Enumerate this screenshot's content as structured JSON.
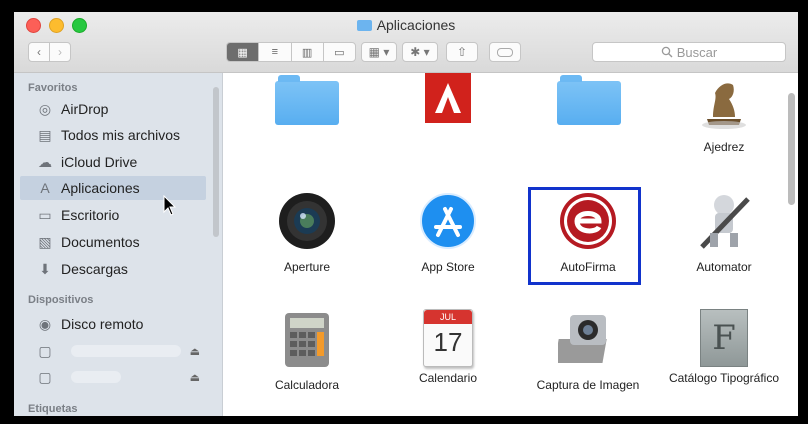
{
  "window": {
    "title": "Aplicaciones"
  },
  "toolbar": {
    "back": "‹",
    "forward": "›",
    "view_icons": "▦",
    "view_list": "≡",
    "view_columns": "▥",
    "view_coverflow": "▭",
    "arrange": "▦ ▾",
    "action": "✱ ▾",
    "share": "⇧",
    "search_placeholder": "Buscar"
  },
  "sidebar": {
    "favorites_label": "Favoritos",
    "favorites": [
      {
        "label": "AirDrop",
        "icon": "airdrop-icon",
        "glyph": "◎"
      },
      {
        "label": "Todos mis archivos",
        "icon": "all-files-icon",
        "glyph": "▤"
      },
      {
        "label": "iCloud Drive",
        "icon": "cloud-icon",
        "glyph": "☁"
      },
      {
        "label": "Aplicaciones",
        "icon": "applications-icon",
        "glyph": "A"
      },
      {
        "label": "Escritorio",
        "icon": "desktop-icon",
        "glyph": "▭"
      },
      {
        "label": "Documentos",
        "icon": "documents-icon",
        "glyph": "▧"
      },
      {
        "label": "Descargas",
        "icon": "downloads-icon",
        "glyph": "⬇"
      }
    ],
    "devices_label": "Dispositivos",
    "devices": [
      {
        "label": "Disco remoto",
        "icon": "remote-disc-icon",
        "glyph": "◉"
      },
      {
        "label": "",
        "icon": "drive-icon",
        "glyph": "▢",
        "eject": "⏏"
      },
      {
        "label": "",
        "icon": "drive-icon",
        "glyph": "▢",
        "eject": "⏏"
      }
    ],
    "tags_label": "Etiquetas"
  },
  "apps": {
    "row1": [
      "",
      "",
      "",
      "Ajedrez"
    ],
    "row2": [
      "Aperture",
      "App Store",
      "AutoFirma",
      "Automator"
    ],
    "row3": [
      "Calculadora",
      "Calendario",
      "Captura de Imagen",
      "Catálogo Tipográfico"
    ]
  },
  "calendar_icon": {
    "month": "JUL",
    "day": "17"
  },
  "colors": {
    "highlight_border": "#1133cc",
    "selected_row": "#c5d1e0",
    "folder_blue": "#58aef0",
    "adobe_red": "#d1221c",
    "autofirma_red": "#b51a22"
  }
}
